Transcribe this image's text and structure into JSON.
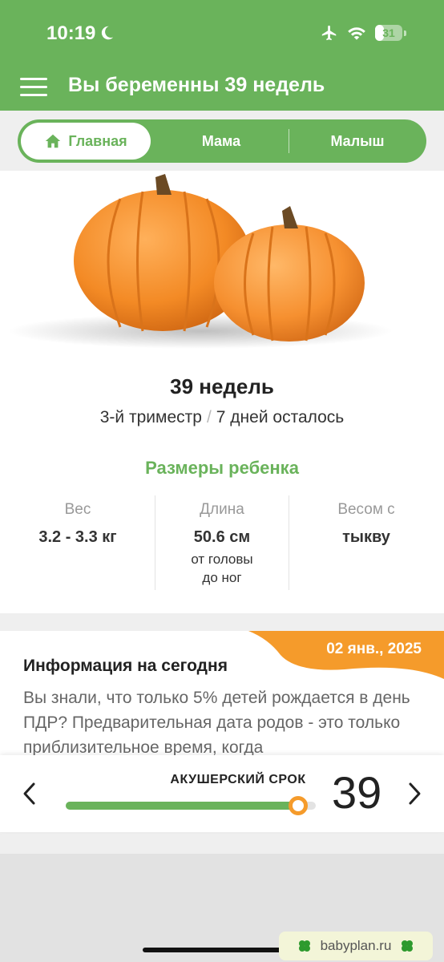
{
  "status_bar": {
    "time": "10:19",
    "battery": "31",
    "battery_level": 0.31
  },
  "app_bar": {
    "title": "Вы беременны 39 недель"
  },
  "tabs": [
    {
      "label": "Главная",
      "selected": true
    },
    {
      "label": "Мама",
      "selected": false
    },
    {
      "label": "Малыш",
      "selected": false
    }
  ],
  "hero": {
    "week_title": "39 недель",
    "trimester": "3-й триместр",
    "separator": "/",
    "days_left": "7 дней осталось"
  },
  "sizes": {
    "heading": "Размеры ребенка",
    "stats": [
      {
        "label": "Вес",
        "value": "3.2 - 3.3 кг",
        "note": ""
      },
      {
        "label": "Длина",
        "value": "50.6 см",
        "note": "от головы до ног"
      },
      {
        "label": "Весом с",
        "value": "тыкву",
        "note": ""
      }
    ]
  },
  "info": {
    "date": "02 янв., 2025",
    "title": "Информация на сегодня",
    "body": "Вы знали, что только 5% детей рождается в день ПДР? Предварительная дата родов - это только приблизительное время, когда"
  },
  "term": {
    "label": "АКУШЕРСКИЙ СРОК",
    "week": "39",
    "progress": 0.93
  },
  "watermark": {
    "text": "babyplan.ru"
  },
  "colors": {
    "accent": "#6ab35b",
    "orange": "#f59b2b"
  },
  "icons": [
    "moon-icon",
    "airplane-icon",
    "wifi-icon",
    "battery-icon",
    "menu-icon",
    "home-icon",
    "chevron-left-icon",
    "chevron-right-icon",
    "clover-icon"
  ]
}
